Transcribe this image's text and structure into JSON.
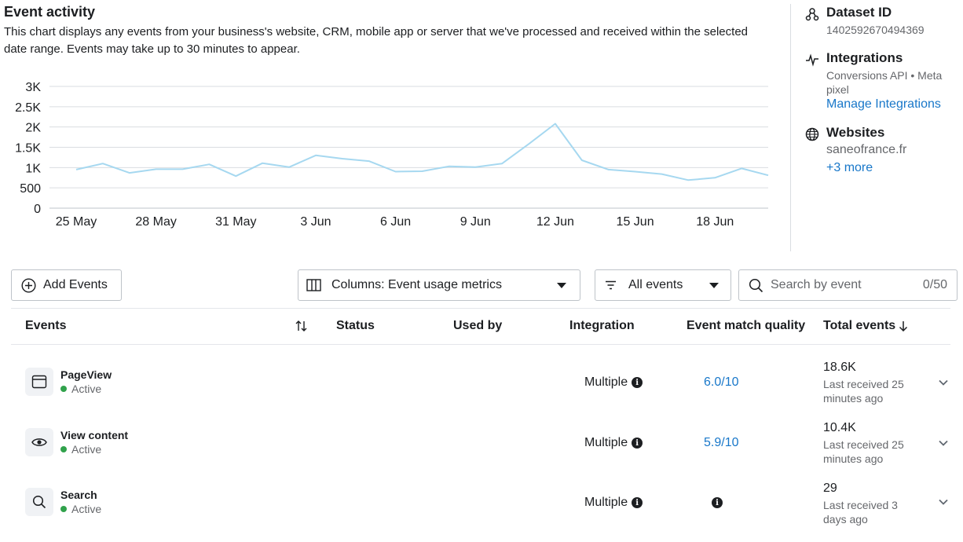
{
  "header": {
    "title": "Event activity",
    "description": "This chart displays any events from your business's website, CRM, mobile app or server that we've processed and received within the selected date range. Events may take up to 30 minutes to appear."
  },
  "chart_data": {
    "type": "line",
    "x": [
      "25 May",
      "26 May",
      "27 May",
      "28 May",
      "29 May",
      "30 May",
      "31 May",
      "1 Jun",
      "2 Jun",
      "3 Jun",
      "4 Jun",
      "5 Jun",
      "6 Jun",
      "7 Jun",
      "8 Jun",
      "9 Jun",
      "10 Jun",
      "11 Jun",
      "12 Jun",
      "13 Jun",
      "14 Jun",
      "15 Jun",
      "16 Jun",
      "17 Jun",
      "18 Jun",
      "19 Jun",
      "20 Jun"
    ],
    "values": [
      950,
      1100,
      870,
      960,
      960,
      1080,
      790,
      1110,
      1010,
      1300,
      1220,
      1160,
      900,
      910,
      1030,
      1010,
      1100,
      1580,
      2080,
      1180,
      950,
      900,
      840,
      690,
      750,
      980,
      810
    ],
    "x_tick_labels": [
      "25 May",
      "28 May",
      "31 May",
      "3 Jun",
      "6 Jun",
      "9 Jun",
      "12 Jun",
      "15 Jun",
      "18 Jun"
    ],
    "y_tick_labels": [
      "0",
      "500",
      "1K",
      "1.5K",
      "2K",
      "2.5K",
      "3K"
    ],
    "ylim": [
      0,
      3000
    ],
    "grid": true,
    "color": "#a6d8f0"
  },
  "sidebar": {
    "dataset": {
      "icon": "dataset-icon",
      "title": "Dataset ID",
      "value": "1402592670494369"
    },
    "integrations": {
      "icon": "pulse-icon",
      "title": "Integrations",
      "value": "Conversions API • Meta pixel",
      "link": "Manage Integrations"
    },
    "websites": {
      "icon": "globe-icon",
      "title": "Websites",
      "value": "saneofrance.fr",
      "link": "+3 more"
    }
  },
  "toolbar": {
    "add_events": "Add Events",
    "columns": "Columns: Event usage metrics",
    "filter": "All events",
    "search_placeholder": "Search by event",
    "search_count": "0/50"
  },
  "table": {
    "headers": {
      "events": "Events",
      "status": "Status",
      "used_by": "Used by",
      "integration": "Integration",
      "emq": "Event match quality",
      "total": "Total events"
    },
    "rows": [
      {
        "icon": "browser-window-icon",
        "name": "PageView",
        "status": "Active",
        "integration": "Multiple",
        "emq": "6.0/10",
        "total": "18.6K",
        "last": "Last received 25 minutes ago"
      },
      {
        "icon": "eye-icon",
        "name": "View content",
        "status": "Active",
        "integration": "Multiple",
        "emq": "5.9/10",
        "total": "10.4K",
        "last": "Last received 25 minutes ago"
      },
      {
        "icon": "search-icon",
        "name": "Search",
        "status": "Active",
        "integration": "Multiple",
        "emq": "",
        "total": "29",
        "last": "Last received 3 days ago"
      }
    ]
  },
  "colors": {
    "link": "#1877c9",
    "active": "#31a24c",
    "chart_line": "#a6d8f0"
  }
}
